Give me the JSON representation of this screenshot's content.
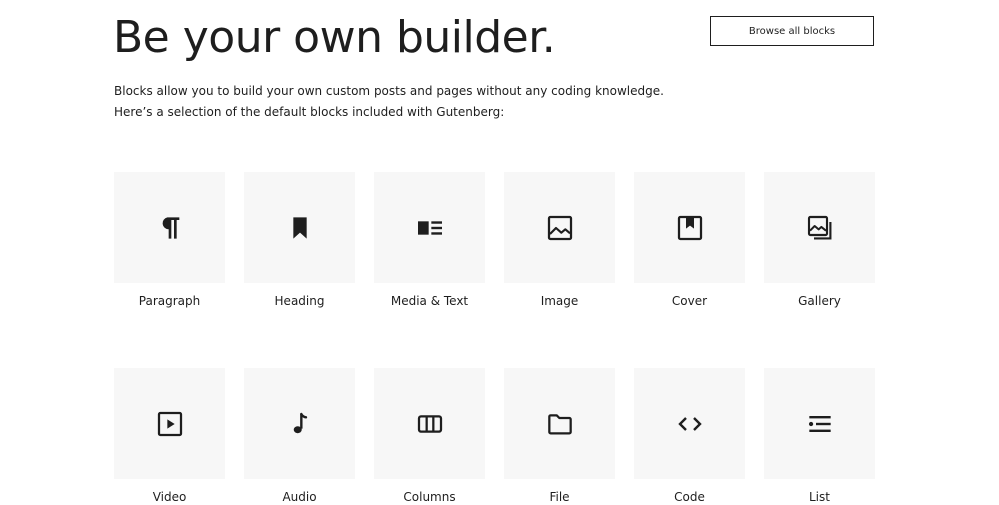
{
  "header": {
    "title": "Be your own builder.",
    "browse_button_label": "Browse all blocks"
  },
  "intro": {
    "line1": "Blocks allow you to build your own custom posts and pages without any coding knowledge.",
    "line2": "Here’s a selection of the default blocks included with Gutenberg:"
  },
  "colors": {
    "text": "#1e1e1e",
    "tile_background": "#f7f7f7",
    "page_background": "#ffffff"
  },
  "blocks": [
    {
      "label": "Paragraph",
      "icon": "paragraph-icon"
    },
    {
      "label": "Heading",
      "icon": "bookmark-icon"
    },
    {
      "label": "Media & Text",
      "icon": "media-text-icon"
    },
    {
      "label": "Image",
      "icon": "image-icon"
    },
    {
      "label": "Cover",
      "icon": "cover-icon"
    },
    {
      "label": "Gallery",
      "icon": "gallery-icon"
    },
    {
      "label": "Video",
      "icon": "video-icon"
    },
    {
      "label": "Audio",
      "icon": "audio-icon"
    },
    {
      "label": "Columns",
      "icon": "columns-icon"
    },
    {
      "label": "File",
      "icon": "file-icon"
    },
    {
      "label": "Code",
      "icon": "code-icon"
    },
    {
      "label": "List",
      "icon": "list-icon"
    }
  ]
}
